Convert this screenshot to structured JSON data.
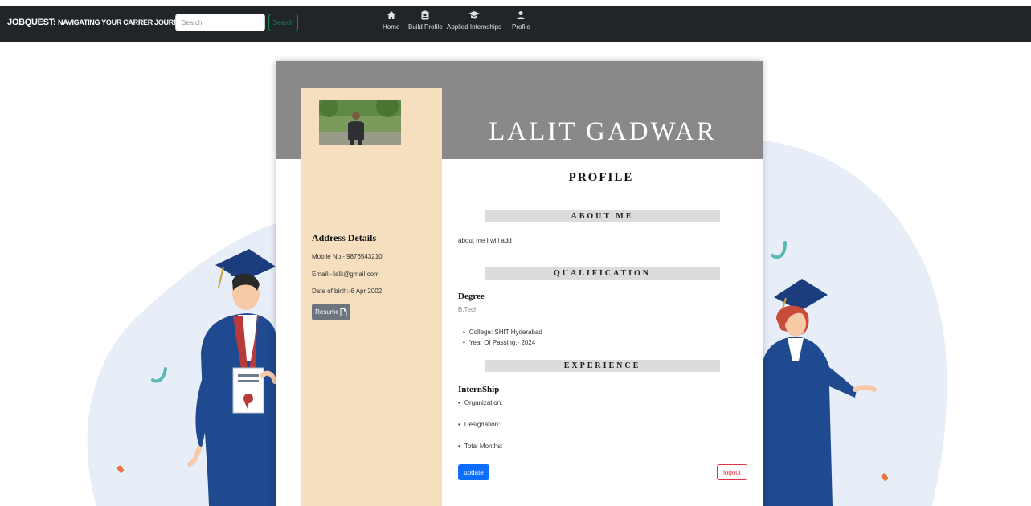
{
  "navbar": {
    "brand": "JOBQUEST:",
    "brand_sub": "NAVIGATING YOUR CARRER JOURNEY",
    "search_placeholder": "Search",
    "search_button": "Search",
    "items": [
      {
        "label": "Home",
        "icon": "home-icon"
      },
      {
        "label": "Build Profile",
        "icon": "id-badge-icon"
      },
      {
        "label": "Applied Internships",
        "icon": "graduation-cap-icon"
      },
      {
        "label": "Profile",
        "icon": "user-icon"
      }
    ]
  },
  "resume": {
    "name": "LALIT GADWAR",
    "sidebar": {
      "address_title": "Address Details",
      "mobile": "Mobile No:- 9876543210",
      "email": "Email:- lalit@gmail.com",
      "dob": "Date of birth:-6 Apr 2002",
      "resume_button": "Resume"
    },
    "profile_title": "PROFILE",
    "about": {
      "heading": "ABOUT ME",
      "text": "about me I will add"
    },
    "qualification": {
      "heading": "QUALIFICATION",
      "degree_title": "Degree",
      "degree": "B.Tech",
      "college": "College: SHIT Hyderabad",
      "year": "Year Of Passing:- 2024"
    },
    "experience": {
      "heading": "EXPERIENCE",
      "title": "InternShip",
      "organization": "Organization:",
      "designation": "Designation:",
      "months": "Total Months:"
    },
    "update_button": "update",
    "logout_button": "logout"
  },
  "colors": {
    "navbar_bg": "#212529",
    "header_gray": "#898989",
    "sidebar_bg": "#f6dfbf",
    "section_bar": "#dcdcdc",
    "primary": "#0d6efd",
    "success": "#198754",
    "danger": "#dc3545",
    "gown_blue": "#1f4a8f"
  }
}
